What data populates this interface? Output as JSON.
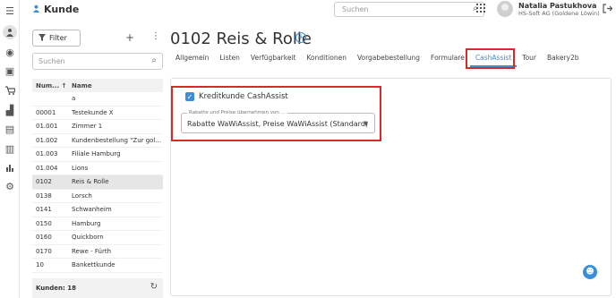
{
  "topbar": {
    "app_title": "Kunde",
    "search_placeholder": "Suchen",
    "user_name": "Natalia Pastukhova",
    "user_company": "HS-Soft AG (Goldene Löwin)"
  },
  "icons": {
    "menu": "menu-icon",
    "person": "person-icon",
    "search": "search-icon",
    "grid": "apps-grid-icon",
    "logout": "logout-icon",
    "filter": "filter-icon",
    "plus": "plus-icon",
    "more": "more-vert-icon",
    "refresh": "refresh-icon",
    "info": "info-icon",
    "bot": "chatbot-icon"
  },
  "left_panel": {
    "filter_label": "Filter",
    "search_placeholder": "Suchen",
    "columns": [
      "Num... ↑",
      "Name"
    ],
    "rows": [
      {
        "num": "",
        "name": "a",
        "selected": false
      },
      {
        "num": "00001",
        "name": "Testekunde X",
        "selected": false
      },
      {
        "num": "01.001",
        "name": "Zimmer 1",
        "selected": false
      },
      {
        "num": "01.002",
        "name": "Kundenbestellung \"Zur gol...",
        "selected": false
      },
      {
        "num": "01.003",
        "name": "Filiale Hamburg",
        "selected": false
      },
      {
        "num": "01.004",
        "name": "Lions",
        "selected": false
      },
      {
        "num": "0102",
        "name": "Reis & Rolle",
        "selected": true
      },
      {
        "num": "0138",
        "name": "Lorsch",
        "selected": false
      },
      {
        "num": "0141",
        "name": "Schwanheim",
        "selected": false
      },
      {
        "num": "0150",
        "name": "Hamburg",
        "selected": false
      },
      {
        "num": "0160",
        "name": "Quickborn",
        "selected": false
      },
      {
        "num": "0170",
        "name": "Rewe - Fürth",
        "selected": false
      },
      {
        "num": "10",
        "name": "Bankettkunde",
        "selected": false
      }
    ],
    "footer": "Kunden: 18"
  },
  "main": {
    "title": "0102 Reis & Rolle",
    "tabs": [
      "Allgemein",
      "Listen",
      "Verfügbarkeit",
      "Konditionen",
      "Vorgabebestellung",
      "Formulare",
      "CashAssist",
      "Tour",
      "Bakery2b"
    ],
    "active_tab": "CashAssist",
    "checkbox_label": "Kreditkunde CashAssist",
    "select_legend": "Rabatte und Preise übernehmen von ...",
    "select_value": "Rabatte WaWiAssist, Preise WaWiAssist (Standard)"
  },
  "colors": {
    "accent": "#3b8fd9",
    "highlight": "#d42a2a"
  }
}
